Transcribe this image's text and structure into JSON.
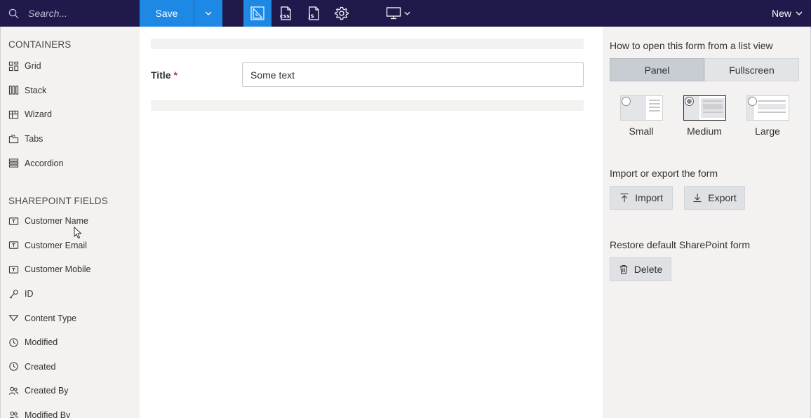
{
  "toolbar": {
    "search_placeholder": "Search...",
    "save_label": "Save",
    "new_label": "New"
  },
  "containers": {
    "heading": "CONTAINERS",
    "items": [
      {
        "label": "Grid",
        "icon": "grid-icon"
      },
      {
        "label": "Stack",
        "icon": "stack-icon"
      },
      {
        "label": "Wizard",
        "icon": "wizard-icon"
      },
      {
        "label": "Tabs",
        "icon": "tabs-icon"
      },
      {
        "label": "Accordion",
        "icon": "accordion-icon"
      }
    ]
  },
  "fields": {
    "heading": "SHAREPOINT FIELDS",
    "items": [
      {
        "label": "Customer Name",
        "icon": "text-field-icon"
      },
      {
        "label": "Customer Email",
        "icon": "text-field-icon"
      },
      {
        "label": "Customer Mobile",
        "icon": "text-field-icon"
      },
      {
        "label": "ID",
        "icon": "key-icon"
      },
      {
        "label": "Content Type",
        "icon": "filter-icon"
      },
      {
        "label": "Modified",
        "icon": "clock-icon"
      },
      {
        "label": "Created",
        "icon": "clock-icon"
      },
      {
        "label": "Created By",
        "icon": "people-icon"
      },
      {
        "label": "Modified By",
        "icon": "people-icon"
      }
    ]
  },
  "form": {
    "title_label": "Title",
    "required_mark": "*",
    "title_value": "Some text"
  },
  "settings": {
    "open_heading": "How to open this form from a list view",
    "open_options": [
      "Panel",
      "Fullscreen"
    ],
    "open_selected": "Panel",
    "sizes": [
      "Small",
      "Medium",
      "Large"
    ],
    "size_selected": "Medium",
    "import_heading": "Import or export the form",
    "import_label": "Import",
    "export_label": "Export",
    "restore_heading": "Restore default SharePoint form",
    "delete_label": "Delete"
  },
  "colors": {
    "topbar": "#201a4c",
    "accent": "#1e88e5",
    "panel_bg": "#f3f2f1",
    "required": "#c4314b"
  }
}
